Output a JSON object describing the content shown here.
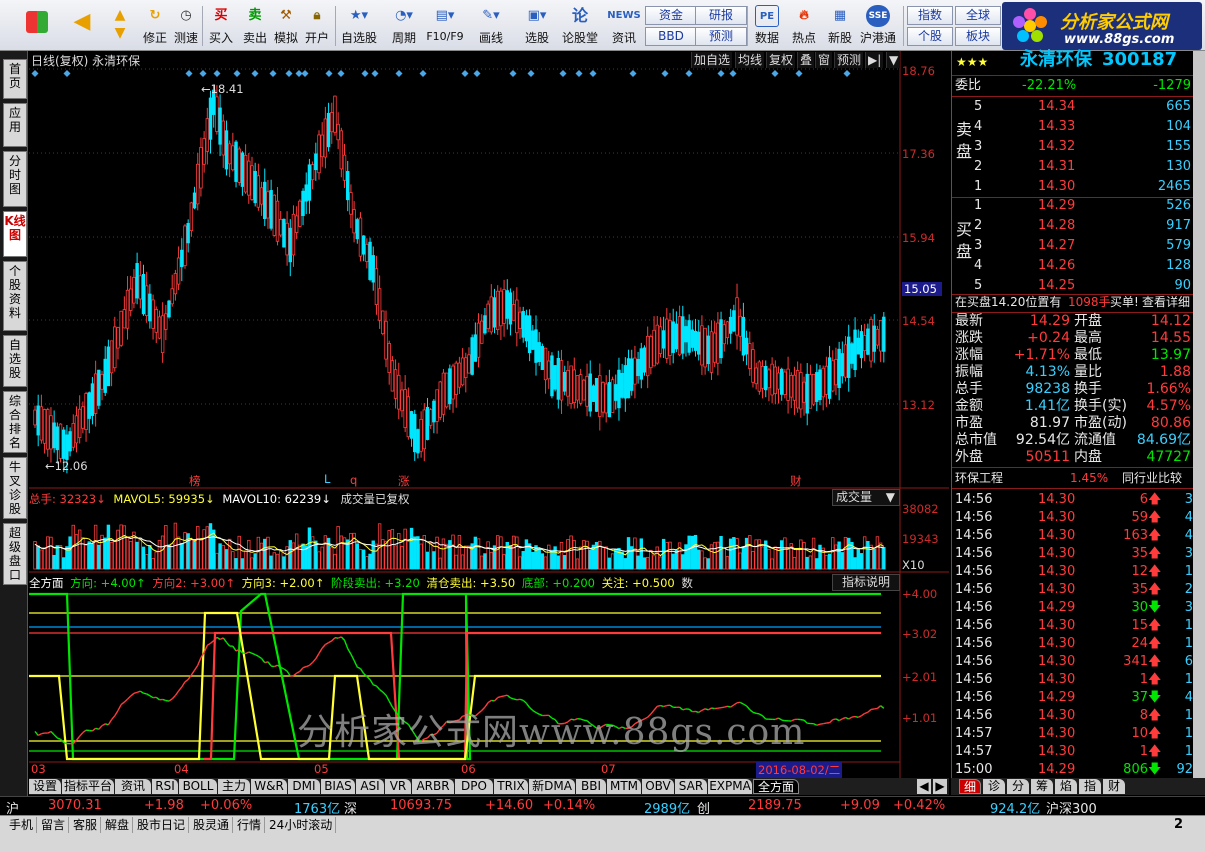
{
  "toolbar": {
    "buttons": [
      "修正",
      "测速",
      "买入",
      "卖出",
      "模拟",
      "开户",
      "自选股",
      "周期",
      "F10/F9",
      "画线",
      "选股",
      "论股堂",
      "资讯",
      "数据",
      "热点",
      "新股",
      "沪港通"
    ],
    "mini": [
      "资金",
      "研报",
      "BBD",
      "预测",
      "指数",
      "全球",
      "个股",
      "板块"
    ],
    "logo_brand": "分析家公式网",
    "logo_site": "www.88gs.com"
  },
  "left_tabs": [
    "首页",
    "应用",
    "分时图",
    "K线图",
    "个股资料",
    "自选股",
    "综合排名",
    "牛叉诊股",
    "超级盘口"
  ],
  "chart": {
    "title": "日线(复权) 永清环保",
    "mini_buttons": [
      "加自选",
      "均线",
      "复权",
      "叠",
      "窗",
      "预测",
      "▶|",
      "▼"
    ],
    "price_labels": [
      "18.76",
      "17.36",
      "15.94",
      "15.05",
      "14.54",
      "13.12"
    ],
    "high_marker": "18.41",
    "low_marker": "12.06",
    "event_labels": [
      "榜",
      "L",
      "q",
      "涨",
      "财"
    ],
    "vol_row": {
      "total": "总手: 32323↓",
      "mavol5": "MAVOL5: 59935↓",
      "mavol10": "MAVOL10: 62239↓",
      "note": "成交量已复权",
      "select": "成交量"
    },
    "vol_labels": [
      "38082",
      "19343",
      "X10"
    ],
    "ind_row": {
      "name": "全方面",
      "a": "方向: +4.00↑",
      "b": "方向2: +3.00↑",
      "c": "方向3: +2.00↑",
      "d": "阶段卖出: +3.20",
      "e": "清仓卖出: +3.50",
      "f": "底部: +0.200",
      "g": "关注: +0.500",
      "h": "数",
      "btn": "指标说明"
    },
    "ind_labels": [
      "+4.00",
      "+3.02",
      "+2.01",
      "+1.01"
    ],
    "x_labels": [
      "03",
      "04",
      "05",
      "06",
      "07"
    ],
    "date_tag": "2016-08-02/二",
    "watermark": "分析家公式网www.88gs.com"
  },
  "quote": {
    "name": "永清环保",
    "code": "300187",
    "stars": "★★★",
    "ratio_label": "委比",
    "ratio": "-22.21%",
    "ratio_diff": "-1279",
    "sell_label": "卖盘",
    "buy_label": "买盘",
    "sells": [
      {
        "n": "5",
        "p": "14.34",
        "v": "665"
      },
      {
        "n": "4",
        "p": "14.33",
        "v": "104"
      },
      {
        "n": "3",
        "p": "14.32",
        "v": "155"
      },
      {
        "n": "2",
        "p": "14.31",
        "v": "130"
      },
      {
        "n": "1",
        "p": "14.30",
        "v": "2465"
      }
    ],
    "buys": [
      {
        "n": "1",
        "p": "14.29",
        "v": "526"
      },
      {
        "n": "2",
        "p": "14.28",
        "v": "917"
      },
      {
        "n": "3",
        "p": "14.27",
        "v": "579"
      },
      {
        "n": "4",
        "p": "14.26",
        "v": "128"
      },
      {
        "n": "5",
        "p": "14.25",
        "v": "90"
      }
    ],
    "notice": "在买盘14.20位置有",
    "notice_vol": "1098手",
    "notice_tail": "买单!",
    "notice_link": "查看详细",
    "stats": [
      [
        "最新",
        "14.29",
        "开盘",
        "14.12"
      ],
      [
        "涨跌",
        "+0.24",
        "最高",
        "14.55"
      ],
      [
        "涨幅",
        "+1.71%",
        "最低",
        "13.97"
      ],
      [
        "振幅",
        "4.13%",
        "量比",
        "1.88"
      ],
      [
        "总手",
        "98238",
        "换手",
        "1.66%"
      ],
      [
        "金额",
        "1.41亿",
        "换手(实)",
        "4.57%"
      ],
      [
        "市盈",
        "81.97",
        "市盈(动)",
        "80.86"
      ],
      [
        "总市值",
        "92.54亿",
        "流通值",
        "84.69亿"
      ],
      [
        "外盘",
        "50511",
        "内盘",
        "47727"
      ]
    ],
    "industry": "环保工程",
    "industry_pct": "1.45%",
    "compare": "同行业比较",
    "ticks": [
      [
        "14:56",
        "14.30",
        "6",
        "up",
        "3"
      ],
      [
        "14:56",
        "14.30",
        "59",
        "up",
        "4"
      ],
      [
        "14:56",
        "14.30",
        "163",
        "up",
        "4"
      ],
      [
        "14:56",
        "14.30",
        "35",
        "up",
        "3"
      ],
      [
        "14:56",
        "14.30",
        "12",
        "up",
        "1"
      ],
      [
        "14:56",
        "14.30",
        "35",
        "up",
        "2"
      ],
      [
        "14:56",
        "14.29",
        "30",
        "down",
        "3"
      ],
      [
        "14:56",
        "14.30",
        "15",
        "up",
        "1"
      ],
      [
        "14:56",
        "14.30",
        "24",
        "up",
        "1"
      ],
      [
        "14:56",
        "14.30",
        "341",
        "up",
        "6"
      ],
      [
        "14:56",
        "14.30",
        "1",
        "up",
        "1"
      ],
      [
        "14:56",
        "14.29",
        "37",
        "down",
        "4"
      ],
      [
        "14:56",
        "14.30",
        "8",
        "up",
        "1"
      ],
      [
        "14:57",
        "14.30",
        "10",
        "up",
        "1"
      ],
      [
        "14:57",
        "14.30",
        "1",
        "up",
        "1"
      ],
      [
        "15:00",
        "14.29",
        "806",
        "down",
        "92"
      ]
    ]
  },
  "bottom_tabs": [
    "设置",
    "指标平台",
    "资讯",
    "RSI",
    "BOLL",
    "主力",
    "W&R",
    "DMI",
    "BIAS",
    "ASI",
    "VR",
    "ARBR",
    "DPO",
    "TRIX",
    "新DMA",
    "BBI",
    "MTM",
    "OBV",
    "SAR",
    "EXPMA",
    "全方面"
  ],
  "right_tabs": [
    "细",
    "诊",
    "分",
    "筹",
    "焰",
    "指",
    "财"
  ],
  "index_bar": {
    "sh_label": "沪",
    "sh_val": "3070.31",
    "sh_chg": "+1.98",
    "sh_pct": "+0.06%",
    "sh_amt": "1763亿",
    "sz_label": "深",
    "sz_val": "10693.75",
    "sz_chg": "+14.60",
    "sz_pct": "+0.14%",
    "sz_amt": "2989亿",
    "cy_label": "创",
    "cy_val": "2189.75",
    "cy_chg": "+9.09",
    "cy_pct": "+0.42%",
    "cy_amt": "924.2亿",
    "hs_label": "沪深300"
  },
  "status_bar": [
    "手机",
    "留言",
    "客服",
    "解盘",
    "股市日记",
    "股灵通",
    "行情",
    "24小时滚动"
  ],
  "status_right": "2",
  "colors": {
    "up": "#ff3b3b",
    "down": "#00e6ff",
    "green": "#00e600",
    "yellow": "#ffff33"
  }
}
